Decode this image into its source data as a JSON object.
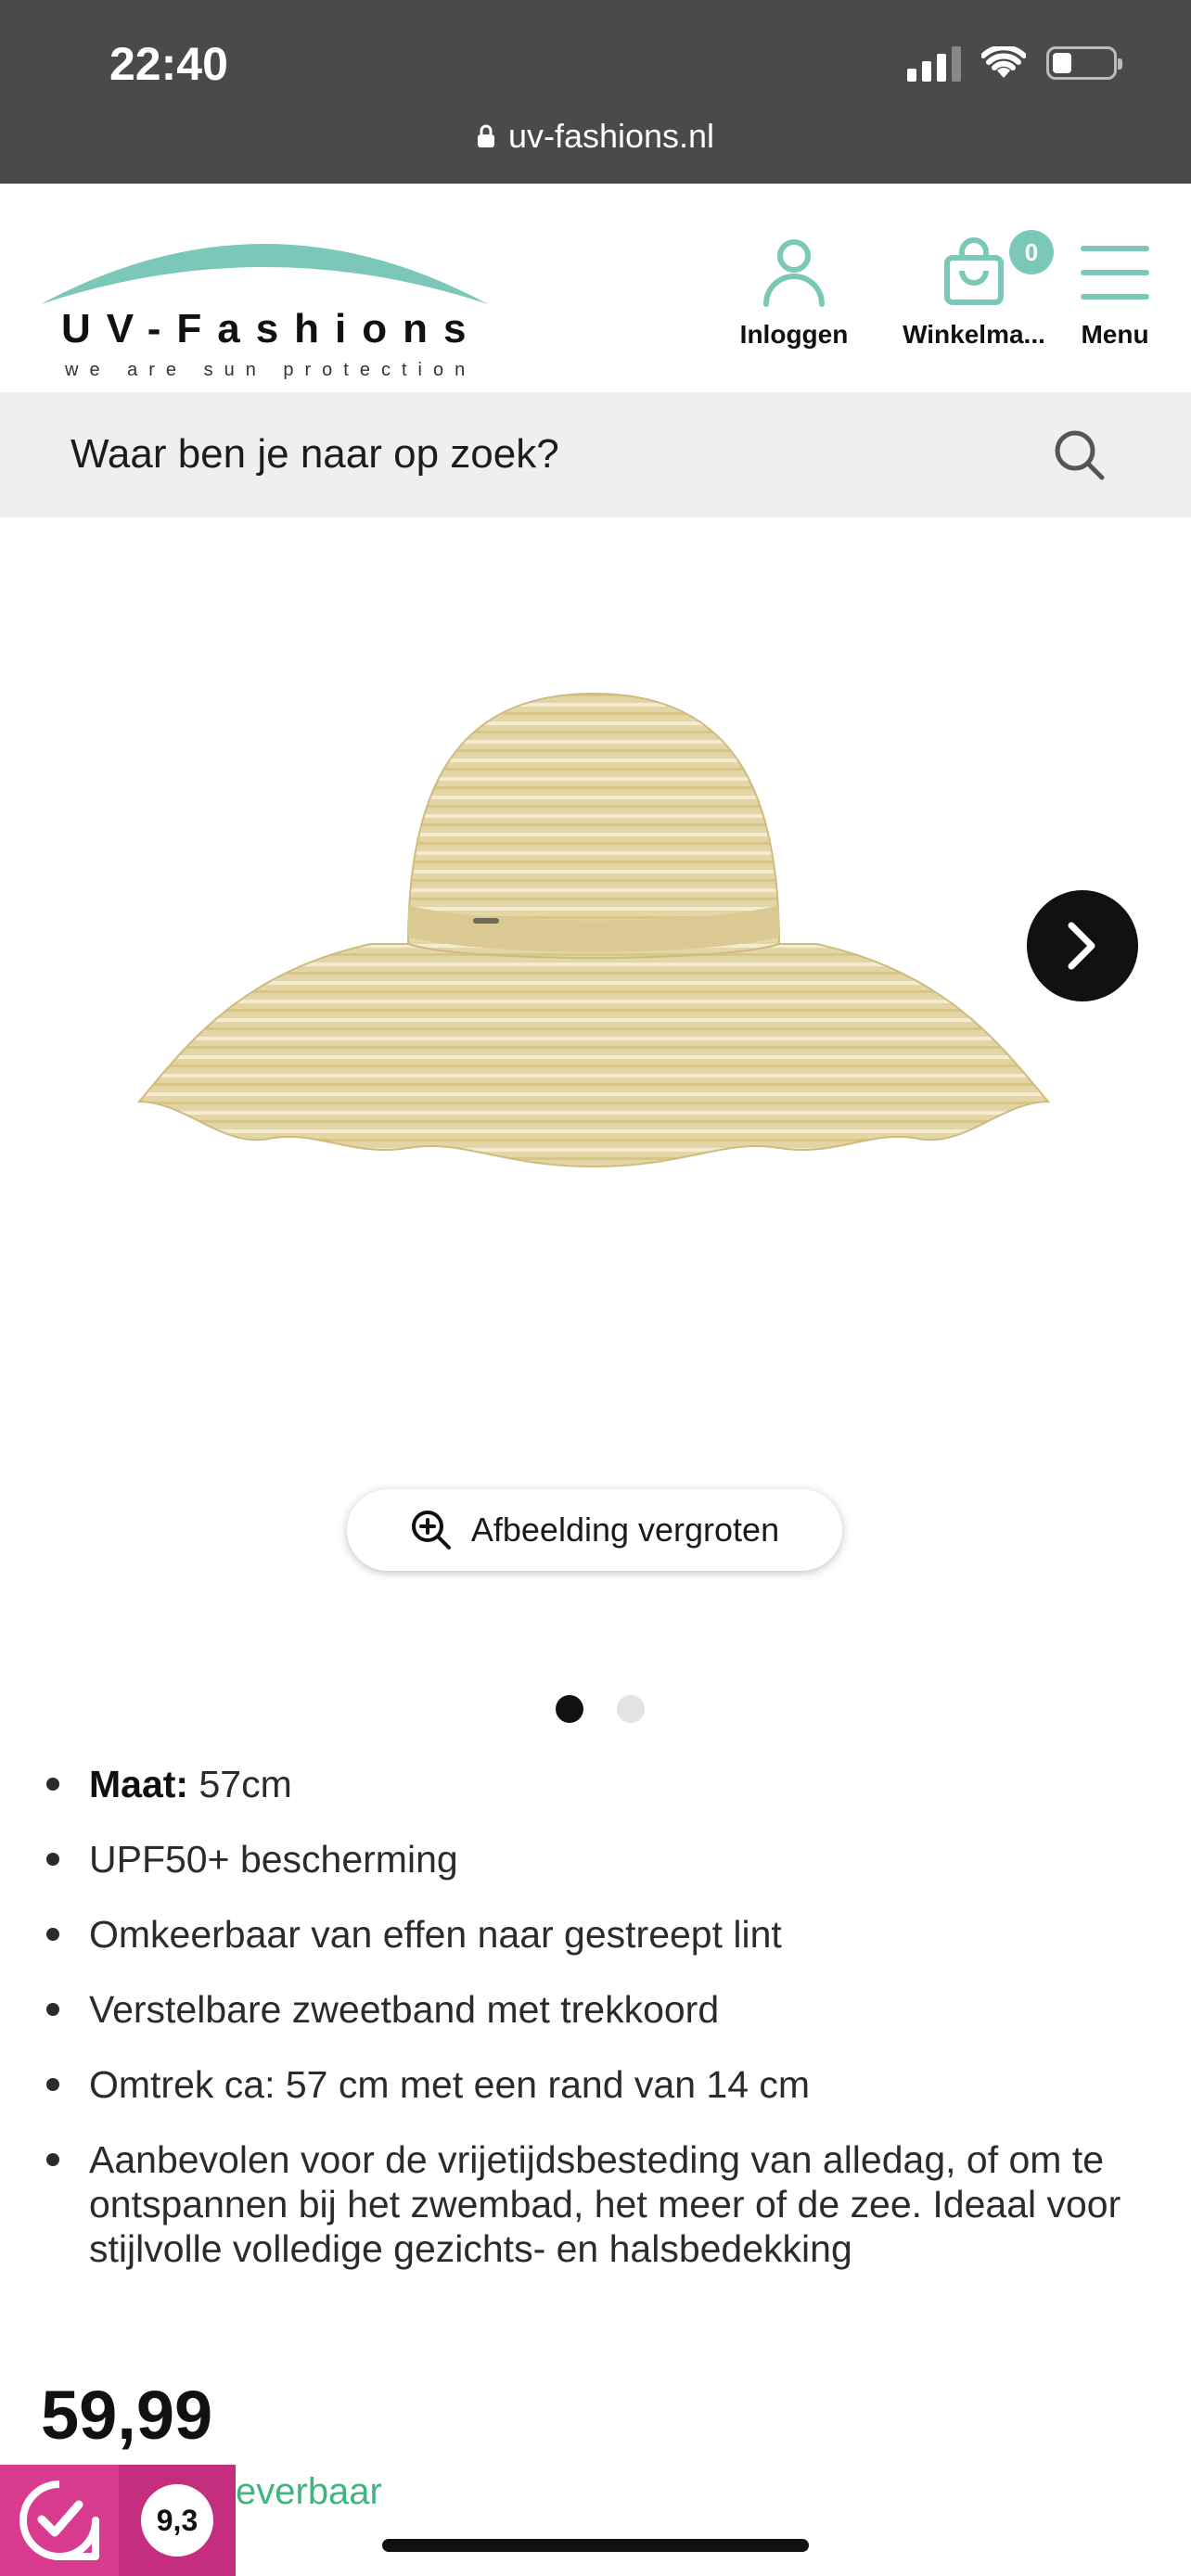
{
  "status_bar": {
    "time": "22:40"
  },
  "browser": {
    "url": "uv-fashions.nl"
  },
  "header": {
    "logo_title": "UV-Fashions",
    "logo_tagline": "we are sun protection",
    "login_label": "Inloggen",
    "cart_label": "Winkelma...",
    "cart_count": "0",
    "menu_label": "Menu",
    "brand_color": "#7cc8b8"
  },
  "search": {
    "placeholder": "Waar ben je naar op zoek?"
  },
  "gallery": {
    "zoom_label": "Afbeelding vergroten",
    "active_slide": 1,
    "slide_count": 2
  },
  "features": {
    "size_label": "Maat:",
    "size_value": " 57cm",
    "items": [
      "UPF50+ bescherming",
      "Omkeerbaar van effen naar gestreept lint",
      "Verstelbare zweetband met trekkoord",
      "Omtrek ca: 57 cm met een rand van 14 cm",
      "Aanbevolen voor de vrijetijdsbesteding van alledag, of om te ontspannen bij het zwembad, het meer of de zee. Ideaal voor stijlvolle volledige gezichts- en halsbedekking"
    ]
  },
  "product": {
    "price": "59,99",
    "availability_partial": "everbaar",
    "availability_color": "#3fb680"
  },
  "review_widget": {
    "score": "9,3",
    "color": "#d93b8e"
  }
}
